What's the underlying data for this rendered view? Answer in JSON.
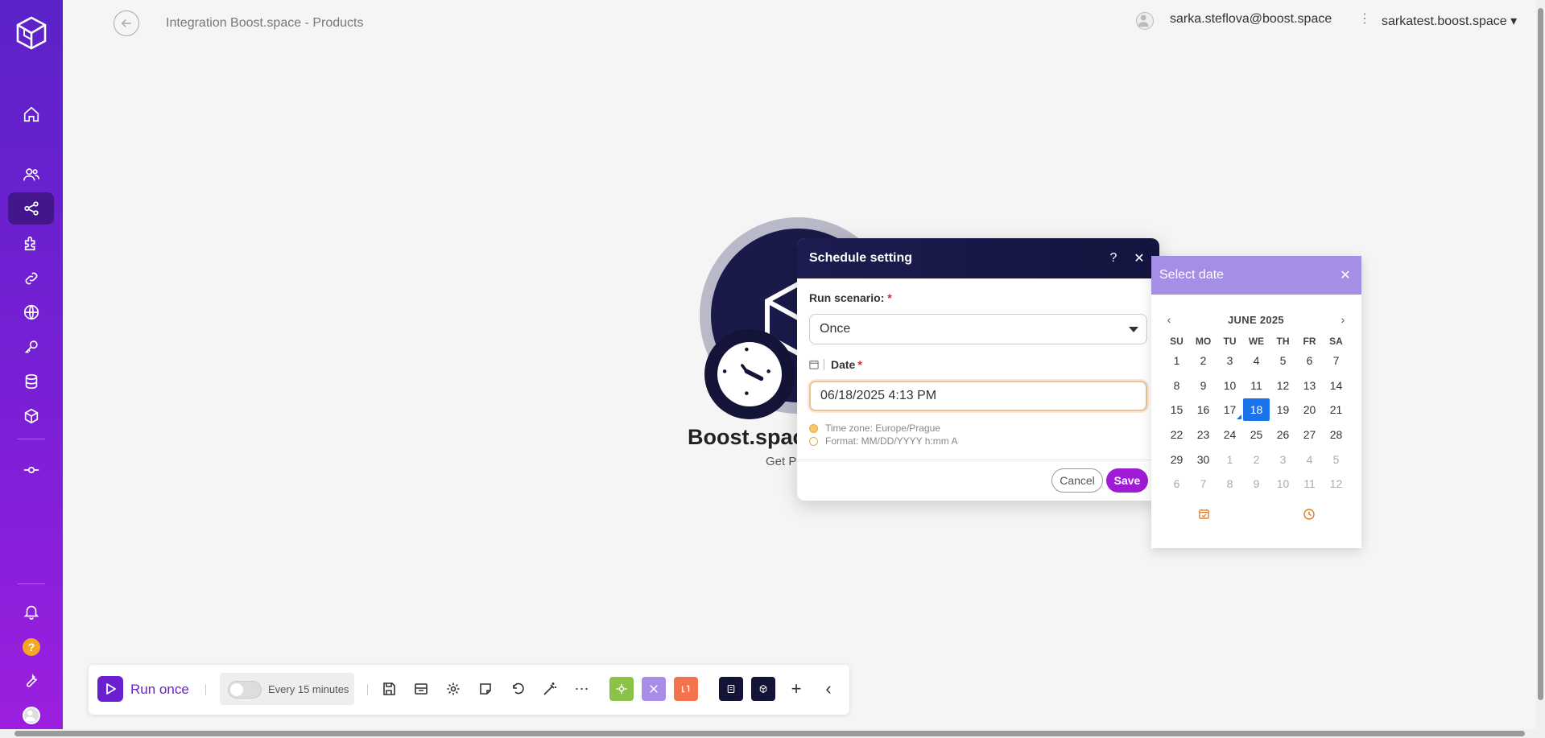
{
  "header": {
    "breadcrumb": "Integration Boost.space - Products",
    "user_email": "sarka.steflova@boost.space",
    "org_name": "sarkatest.boost.space",
    "org_caret": "▾",
    "kebab": "⋮"
  },
  "sidebar": {
    "items": [
      {
        "name": "home-icon"
      },
      {
        "name": "users-icon"
      },
      {
        "name": "scenarios-icon"
      },
      {
        "name": "apps-icon"
      },
      {
        "name": "connections-icon"
      },
      {
        "name": "webhooks-icon"
      },
      {
        "name": "keys-icon"
      },
      {
        "name": "datastores-icon"
      },
      {
        "name": "data-structures-icon"
      },
      {
        "name": "devices-icon"
      },
      {
        "name": "notifications-icon"
      },
      {
        "name": "help-icon"
      },
      {
        "name": "wrench-icon"
      }
    ],
    "help_glyph": "?"
  },
  "module": {
    "title": "Boost.space",
    "subtitle": "Get P"
  },
  "schedule_dialog": {
    "title": "Schedule setting",
    "help": "?",
    "close": "✕",
    "run_label": "Run scenario:",
    "required_mark": "*",
    "run_value": "Once",
    "date_label": "Date",
    "date_value": "06/18/2025 4:13 PM",
    "timezone_hint": "Time zone: Europe/Prague",
    "format_hint": "Format: MM/DD/YYYY h:mm A",
    "cancel_label": "Cancel",
    "save_label": "Save"
  },
  "date_picker": {
    "title": "Select date",
    "close": "✕",
    "prev": "‹",
    "next": "›",
    "month": "JUNE 2025",
    "weekdays": [
      "SU",
      "MO",
      "TU",
      "WE",
      "TH",
      "FR",
      "SA"
    ],
    "weeks": [
      [
        "1",
        "2",
        "3",
        "4",
        "5",
        "6",
        "7"
      ],
      [
        "8",
        "9",
        "10",
        "11",
        "12",
        "13",
        "14"
      ],
      [
        "15",
        "16",
        "17",
        "18",
        "19",
        "20",
        "21"
      ],
      [
        "22",
        "23",
        "24",
        "25",
        "26",
        "27",
        "28"
      ],
      [
        "29",
        "30",
        "1",
        "2",
        "3",
        "4",
        "5"
      ],
      [
        "6",
        "7",
        "8",
        "9",
        "10",
        "11",
        "12"
      ]
    ],
    "selected_day": "18",
    "today_day": "17",
    "muted_from_row": 4
  },
  "toolbar": {
    "run_label": "Run once",
    "schedule_label": "Every 15 minutes",
    "schedule_enabled": false,
    "app_badges": [
      {
        "name": "app-badge-green",
        "color": "#8bc34a"
      },
      {
        "name": "app-badge-purple",
        "color": "#a98be8"
      },
      {
        "name": "app-badge-orange",
        "color": "#f4734f"
      },
      {
        "name": "app-badge-navy-1",
        "color": "#141438"
      },
      {
        "name": "app-badge-navy-2",
        "color": "#141438"
      }
    ],
    "add": "+",
    "collapse": "‹"
  },
  "colors": {
    "brand": "#6a1fd0",
    "save": "#a01bd6",
    "selected_day": "#1a73e8",
    "dialog_header": "#1c1c50",
    "picker_header": "#a58ee6"
  }
}
